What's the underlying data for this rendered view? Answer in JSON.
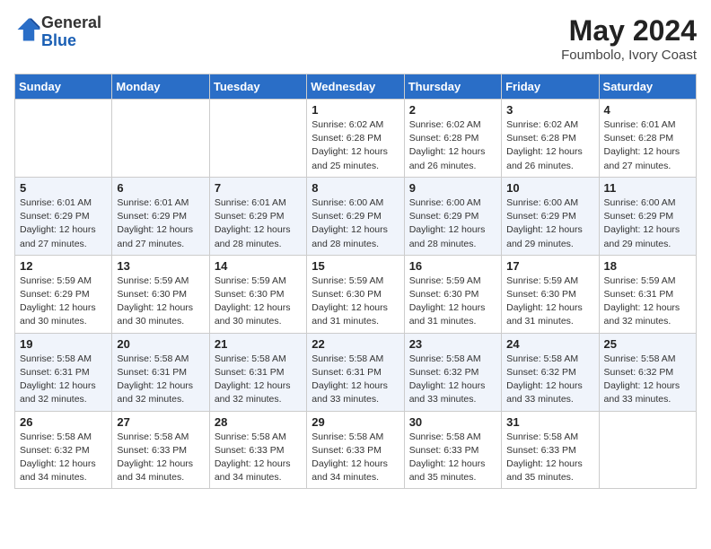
{
  "header": {
    "logo_line1": "General",
    "logo_line2": "Blue",
    "month": "May 2024",
    "location": "Foumbolo, Ivory Coast"
  },
  "days_of_week": [
    "Sunday",
    "Monday",
    "Tuesday",
    "Wednesday",
    "Thursday",
    "Friday",
    "Saturday"
  ],
  "weeks": [
    [
      {
        "day": "",
        "info": ""
      },
      {
        "day": "",
        "info": ""
      },
      {
        "day": "",
        "info": ""
      },
      {
        "day": "1",
        "info": "Sunrise: 6:02 AM\nSunset: 6:28 PM\nDaylight: 12 hours\nand 25 minutes."
      },
      {
        "day": "2",
        "info": "Sunrise: 6:02 AM\nSunset: 6:28 PM\nDaylight: 12 hours\nand 26 minutes."
      },
      {
        "day": "3",
        "info": "Sunrise: 6:02 AM\nSunset: 6:28 PM\nDaylight: 12 hours\nand 26 minutes."
      },
      {
        "day": "4",
        "info": "Sunrise: 6:01 AM\nSunset: 6:28 PM\nDaylight: 12 hours\nand 27 minutes."
      }
    ],
    [
      {
        "day": "5",
        "info": "Sunrise: 6:01 AM\nSunset: 6:29 PM\nDaylight: 12 hours\nand 27 minutes."
      },
      {
        "day": "6",
        "info": "Sunrise: 6:01 AM\nSunset: 6:29 PM\nDaylight: 12 hours\nand 27 minutes."
      },
      {
        "day": "7",
        "info": "Sunrise: 6:01 AM\nSunset: 6:29 PM\nDaylight: 12 hours\nand 28 minutes."
      },
      {
        "day": "8",
        "info": "Sunrise: 6:00 AM\nSunset: 6:29 PM\nDaylight: 12 hours\nand 28 minutes."
      },
      {
        "day": "9",
        "info": "Sunrise: 6:00 AM\nSunset: 6:29 PM\nDaylight: 12 hours\nand 28 minutes."
      },
      {
        "day": "10",
        "info": "Sunrise: 6:00 AM\nSunset: 6:29 PM\nDaylight: 12 hours\nand 29 minutes."
      },
      {
        "day": "11",
        "info": "Sunrise: 6:00 AM\nSunset: 6:29 PM\nDaylight: 12 hours\nand 29 minutes."
      }
    ],
    [
      {
        "day": "12",
        "info": "Sunrise: 5:59 AM\nSunset: 6:29 PM\nDaylight: 12 hours\nand 30 minutes."
      },
      {
        "day": "13",
        "info": "Sunrise: 5:59 AM\nSunset: 6:30 PM\nDaylight: 12 hours\nand 30 minutes."
      },
      {
        "day": "14",
        "info": "Sunrise: 5:59 AM\nSunset: 6:30 PM\nDaylight: 12 hours\nand 30 minutes."
      },
      {
        "day": "15",
        "info": "Sunrise: 5:59 AM\nSunset: 6:30 PM\nDaylight: 12 hours\nand 31 minutes."
      },
      {
        "day": "16",
        "info": "Sunrise: 5:59 AM\nSunset: 6:30 PM\nDaylight: 12 hours\nand 31 minutes."
      },
      {
        "day": "17",
        "info": "Sunrise: 5:59 AM\nSunset: 6:30 PM\nDaylight: 12 hours\nand 31 minutes."
      },
      {
        "day": "18",
        "info": "Sunrise: 5:59 AM\nSunset: 6:31 PM\nDaylight: 12 hours\nand 32 minutes."
      }
    ],
    [
      {
        "day": "19",
        "info": "Sunrise: 5:58 AM\nSunset: 6:31 PM\nDaylight: 12 hours\nand 32 minutes."
      },
      {
        "day": "20",
        "info": "Sunrise: 5:58 AM\nSunset: 6:31 PM\nDaylight: 12 hours\nand 32 minutes."
      },
      {
        "day": "21",
        "info": "Sunrise: 5:58 AM\nSunset: 6:31 PM\nDaylight: 12 hours\nand 32 minutes."
      },
      {
        "day": "22",
        "info": "Sunrise: 5:58 AM\nSunset: 6:31 PM\nDaylight: 12 hours\nand 33 minutes."
      },
      {
        "day": "23",
        "info": "Sunrise: 5:58 AM\nSunset: 6:32 PM\nDaylight: 12 hours\nand 33 minutes."
      },
      {
        "day": "24",
        "info": "Sunrise: 5:58 AM\nSunset: 6:32 PM\nDaylight: 12 hours\nand 33 minutes."
      },
      {
        "day": "25",
        "info": "Sunrise: 5:58 AM\nSunset: 6:32 PM\nDaylight: 12 hours\nand 33 minutes."
      }
    ],
    [
      {
        "day": "26",
        "info": "Sunrise: 5:58 AM\nSunset: 6:32 PM\nDaylight: 12 hours\nand 34 minutes."
      },
      {
        "day": "27",
        "info": "Sunrise: 5:58 AM\nSunset: 6:33 PM\nDaylight: 12 hours\nand 34 minutes."
      },
      {
        "day": "28",
        "info": "Sunrise: 5:58 AM\nSunset: 6:33 PM\nDaylight: 12 hours\nand 34 minutes."
      },
      {
        "day": "29",
        "info": "Sunrise: 5:58 AM\nSunset: 6:33 PM\nDaylight: 12 hours\nand 34 minutes."
      },
      {
        "day": "30",
        "info": "Sunrise: 5:58 AM\nSunset: 6:33 PM\nDaylight: 12 hours\nand 35 minutes."
      },
      {
        "day": "31",
        "info": "Sunrise: 5:58 AM\nSunset: 6:33 PM\nDaylight: 12 hours\nand 35 minutes."
      },
      {
        "day": "",
        "info": ""
      }
    ]
  ]
}
